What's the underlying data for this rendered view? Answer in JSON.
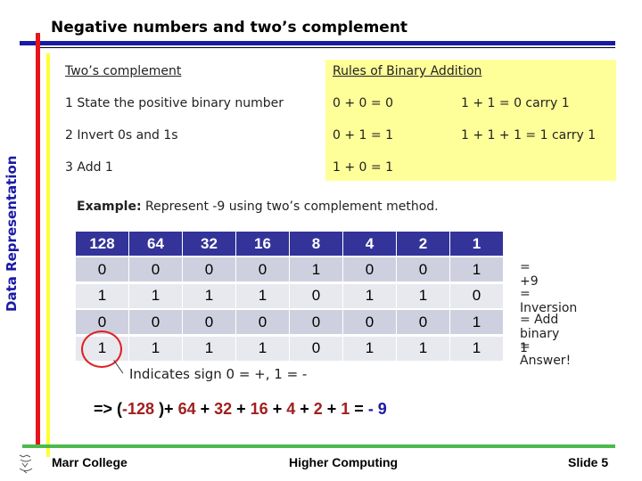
{
  "title": "Negative numbers and two’s complement",
  "side_label": "Data Representation",
  "steps": {
    "heading": "Two’s complement",
    "items": [
      "1  State the positive binary number",
      "2  Invert 0s and 1s",
      "3  Add 1"
    ]
  },
  "rules": {
    "heading": "Rules of Binary Addition",
    "col1": [
      "0 + 0 = 0",
      "0 + 1 = 1",
      "1 + 0 = 1"
    ],
    "col2": [
      "1 + 1 = 0 carry 1",
      "1 + 1 + 1 = 1 carry 1"
    ]
  },
  "example": {
    "bold": "Example:",
    "text": " Represent -9 using two’s complement method."
  },
  "table": {
    "headers": [
      "128",
      "64",
      "32",
      "16",
      "8",
      "4",
      "2",
      "1"
    ],
    "rows": [
      [
        "0",
        "0",
        "0",
        "0",
        "1",
        "0",
        "0",
        "1"
      ],
      [
        "1",
        "1",
        "1",
        "1",
        "0",
        "1",
        "1",
        "0"
      ],
      [
        "0",
        "0",
        "0",
        "0",
        "0",
        "0",
        "0",
        "1"
      ],
      [
        "1",
        "1",
        "1",
        "1",
        "0",
        "1",
        "1",
        "1"
      ]
    ],
    "row_labels": [
      "= +9",
      "= Inversion",
      "= Add binary 1",
      "= Answer!"
    ]
  },
  "sign_note": "Indicates sign 0 = +, 1 = -",
  "sum": {
    "prefix": "=> (",
    "neg": "-128",
    "p1": " )+ ",
    "a": "64",
    "pl": " + ",
    "b": "32",
    "c": "16",
    "d": "4",
    "e": "2",
    "f": "1",
    "eq": " = ",
    "result": "- 9"
  },
  "footer": {
    "left": "Marr College",
    "center": "Higher Computing",
    "right": "Slide 5"
  },
  "colors": {
    "header": "#333399",
    "accent_red": "#a01f1f",
    "accent_blue": "#1a1aa6",
    "rules_bg": "#ffff99"
  }
}
